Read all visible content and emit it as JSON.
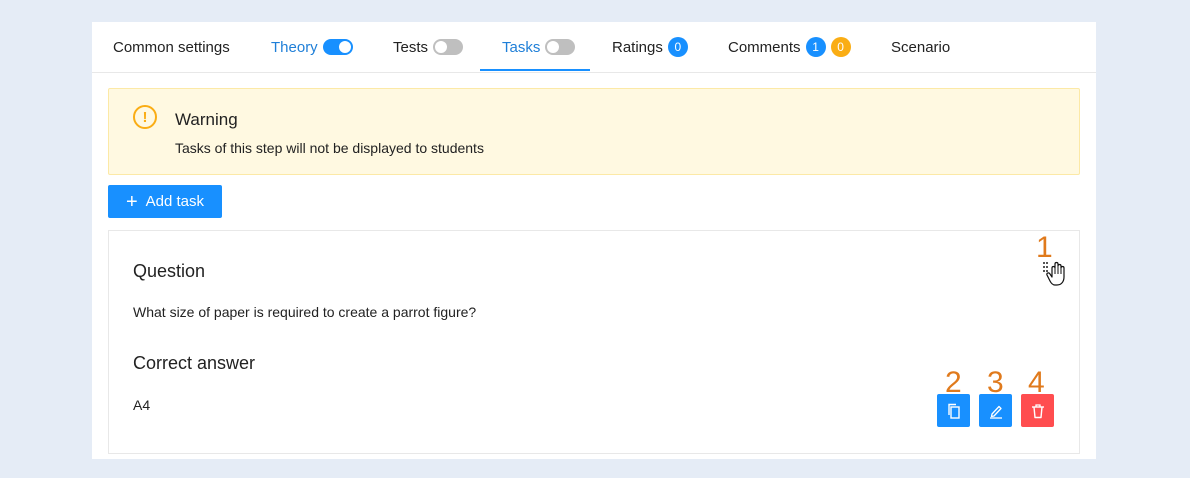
{
  "tabs": [
    {
      "label": "Common settings"
    },
    {
      "label": "Theory",
      "toggle": "on"
    },
    {
      "label": "Tests",
      "toggle": "off"
    },
    {
      "label": "Tasks",
      "toggle": "off",
      "active": true
    },
    {
      "label": "Ratings",
      "badges": [
        "0"
      ]
    },
    {
      "label": "Comments",
      "badges": [
        "1",
        "0"
      ]
    },
    {
      "label": "Scenario"
    }
  ],
  "warning": {
    "title": "Warning",
    "text": "Tasks of this step will not be displayed to students",
    "icon": "exclamation-circle-icon"
  },
  "add_task": {
    "label": "Add task",
    "icon": "plus-icon"
  },
  "task": {
    "question_heading": "Question",
    "question_text": "What size of paper is required to create a parrot figure?",
    "answer_heading": "Correct answer",
    "answer_text": "A4"
  },
  "callouts": [
    "1",
    "2",
    "3",
    "4"
  ],
  "actions": [
    {
      "name": "copy",
      "icon": "copy-icon"
    },
    {
      "name": "edit",
      "icon": "edit-icon"
    },
    {
      "name": "delete",
      "icon": "delete-icon"
    }
  ],
  "colors": {
    "accent": "#1890ff",
    "danger": "#ff4d4f",
    "warning": "#faad14",
    "callout": "#e07a1c",
    "background": "#e5ecf6"
  }
}
